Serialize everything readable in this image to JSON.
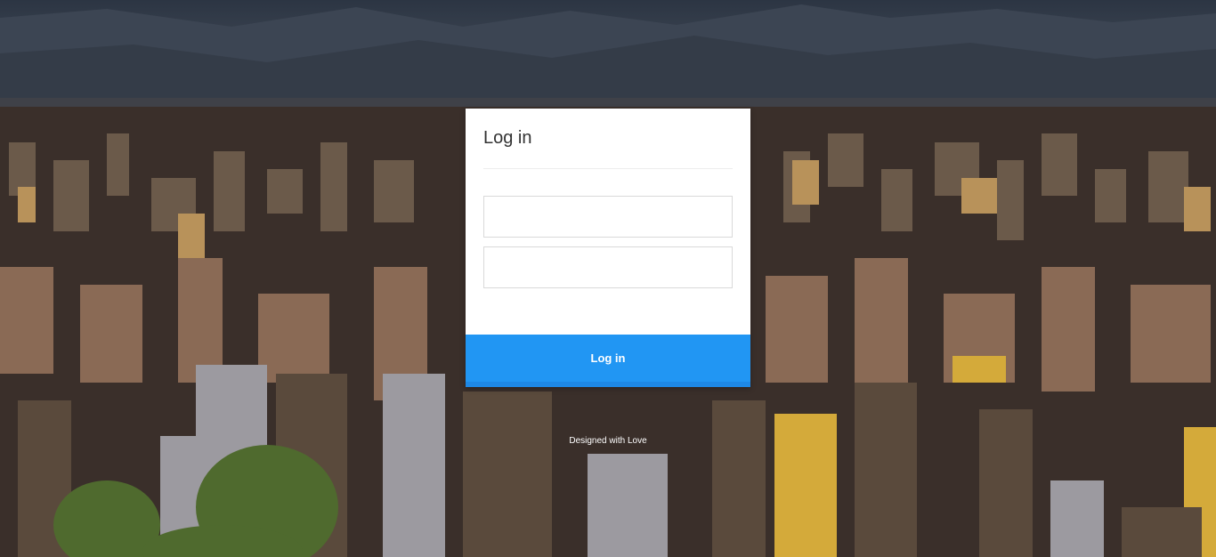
{
  "login": {
    "title": "Log in",
    "username_value": "",
    "password_value": "",
    "submit_label": "Log in"
  },
  "footer": {
    "text": "Designed with Love"
  },
  "colors": {
    "primary": "#2196f3",
    "card_bg": "#ffffff",
    "title_text": "#333333"
  }
}
